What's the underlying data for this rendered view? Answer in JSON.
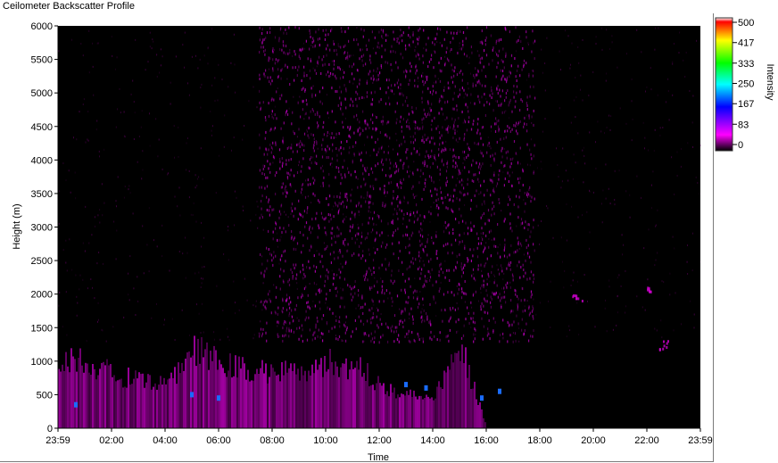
{
  "window": {
    "title": "Ceilometer Backscatter Profile"
  },
  "chart_data": {
    "type": "heatmap",
    "title": "Ceilometer Backscatter Profile",
    "xlabel": "Time",
    "ylabel": "Height (m)",
    "x_ticks": [
      "23:59",
      "02:00",
      "04:00",
      "06:00",
      "08:00",
      "10:00",
      "12:00",
      "14:00",
      "16:00",
      "18:00",
      "20:00",
      "22:00",
      "23:59"
    ],
    "y_ticks": [
      0,
      500,
      1000,
      1500,
      2000,
      2500,
      3000,
      3500,
      4000,
      4500,
      5000,
      5500,
      6000
    ],
    "ylim": [
      0,
      6000
    ],
    "colorbar": {
      "label": "Intensity",
      "ticks": [
        0,
        83,
        167,
        250,
        333,
        417,
        500
      ],
      "range": [
        0,
        500
      ],
      "colors": [
        "#000000",
        "#ff00ff",
        "#0000ff",
        "#00ffff",
        "#00ff00",
        "#ffff00",
        "#ff0000",
        "#ffffff"
      ]
    },
    "features": {
      "boundary_layer_top_m": [
        1100,
        1000,
        850,
        700,
        650,
        1200,
        1000,
        900,
        850,
        900,
        1000,
        950,
        700,
        500,
        450,
        1300,
        0,
        0,
        0,
        0,
        0,
        0,
        0,
        0
      ],
      "noise_band_m": [
        1300,
        6000
      ],
      "noise_band_active_hours": [
        7.5,
        17.8
      ],
      "elevated_layer_points": [
        {
          "time": "19:20",
          "height": 1950
        },
        {
          "time": "22:00",
          "height": 2050
        },
        {
          "time": "22:40",
          "height": 1250
        }
      ],
      "peak_points": [
        {
          "time": "00:40",
          "height": 350
        },
        {
          "time": "05:00",
          "height": 500
        },
        {
          "time": "06:00",
          "height": 450
        },
        {
          "time": "13:00",
          "height": 650
        },
        {
          "time": "13:45",
          "height": 600
        },
        {
          "time": "15:50",
          "height": 450
        },
        {
          "time": "16:30",
          "height": 550
        }
      ]
    }
  }
}
